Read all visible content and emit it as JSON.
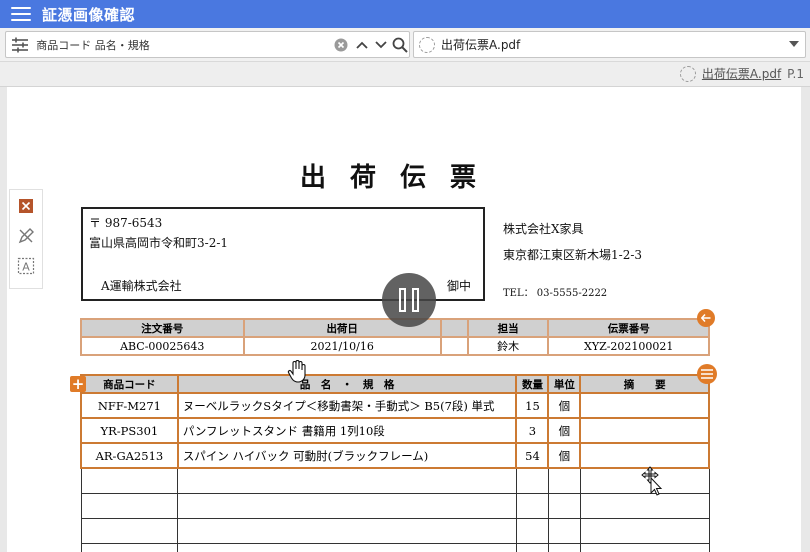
{
  "app": {
    "title": "証憑画像確認"
  },
  "search": {
    "value": "商品コード 品名・規格"
  },
  "file_select": {
    "selected": "出荷伝票A.pdf"
  },
  "subheader": {
    "file_link": "出荷伝票A.pdf",
    "page": "P.1"
  },
  "document": {
    "title": "出荷伝票",
    "address": {
      "postal": "〒 987-6543",
      "line": "富山県高岡市令和町3-2-1",
      "carrier": "A運輸株式会社",
      "recipient_suffix": "御中"
    },
    "sender": {
      "company": "株式会社X家具",
      "address": "東京都江東区新木場1-2-3",
      "tel": "TEL： 03-5555-2222"
    },
    "info_headers": [
      "注文番号",
      "出荷日",
      "担当",
      "伝票番号"
    ],
    "info_values": [
      "ABC-00025643",
      "2021/10/16",
      "鈴木",
      "XYZ-202100021"
    ],
    "item_headers": [
      "商品コード",
      "品　名　・　規　格",
      "数量",
      "単位",
      "摘　　要"
    ],
    "items": [
      {
        "code": "NFF-M271",
        "name": "ヌーベルラックSタイプ＜移動書架・手動式＞ B5(7段) 単式",
        "qty": "15",
        "unit": "個",
        "note": ""
      },
      {
        "code": "YR-PS301",
        "name": "パンフレットスタンド 書籍用 1列10段",
        "qty": "3",
        "unit": "個",
        "note": ""
      },
      {
        "code": "AR-GA2513",
        "name": "スパイン ハイバック 可動肘(ブラックフレーム)",
        "qty": "54",
        "unit": "個",
        "note": ""
      }
    ]
  },
  "colors": {
    "titlebar": "#4a78e0",
    "highlight_orange": "#cc7a33",
    "highlight_light": "#d9a27a"
  },
  "icons": [
    "menu-icon",
    "filter-icon",
    "clear-icon",
    "chevron-up-icon",
    "chevron-down-icon",
    "search-icon",
    "close-icon",
    "edit-icon",
    "text-select-icon",
    "pause-icon",
    "plus-icon",
    "back-icon",
    "list-icon",
    "hand-cursor-icon",
    "move-cursor-icon"
  ]
}
